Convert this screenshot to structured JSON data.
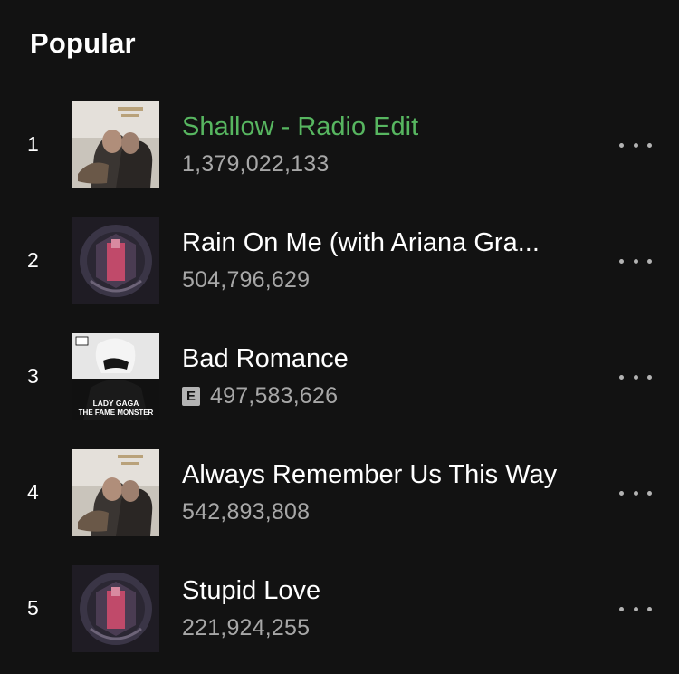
{
  "section": {
    "title": "Popular"
  },
  "tracks": [
    {
      "number": "1",
      "title": "Shallow - Radio Edit",
      "plays": "1,379,022,133",
      "explicit": false,
      "playing": true,
      "cover": "a-star-is-born-cover"
    },
    {
      "number": "2",
      "title": "Rain On Me (with Ariana Gra...",
      "plays": "504,796,629",
      "explicit": false,
      "playing": false,
      "cover": "chromatica-cover"
    },
    {
      "number": "3",
      "title": "Bad Romance",
      "plays": "497,583,626",
      "explicit": true,
      "explicit_label": "E",
      "playing": false,
      "cover": "the-fame-monster-cover",
      "cover_text": {
        "line1": "LADY GAGA",
        "line2": "THE FAME MONSTER"
      }
    },
    {
      "number": "4",
      "title": "Always Remember Us This Way",
      "plays": "542,893,808",
      "explicit": false,
      "playing": false,
      "cover": "a-star-is-born-cover"
    },
    {
      "number": "5",
      "title": "Stupid Love",
      "plays": "221,924,255",
      "explicit": false,
      "playing": false,
      "cover": "chromatica-cover"
    }
  ],
  "colors": {
    "background": "#121212",
    "playing_title": "#57b660",
    "secondary_text": "#a7a7a7",
    "more_dots": "#b3b3b3"
  },
  "icons": {
    "more": "more-options-icon",
    "explicit": "explicit-badge"
  }
}
